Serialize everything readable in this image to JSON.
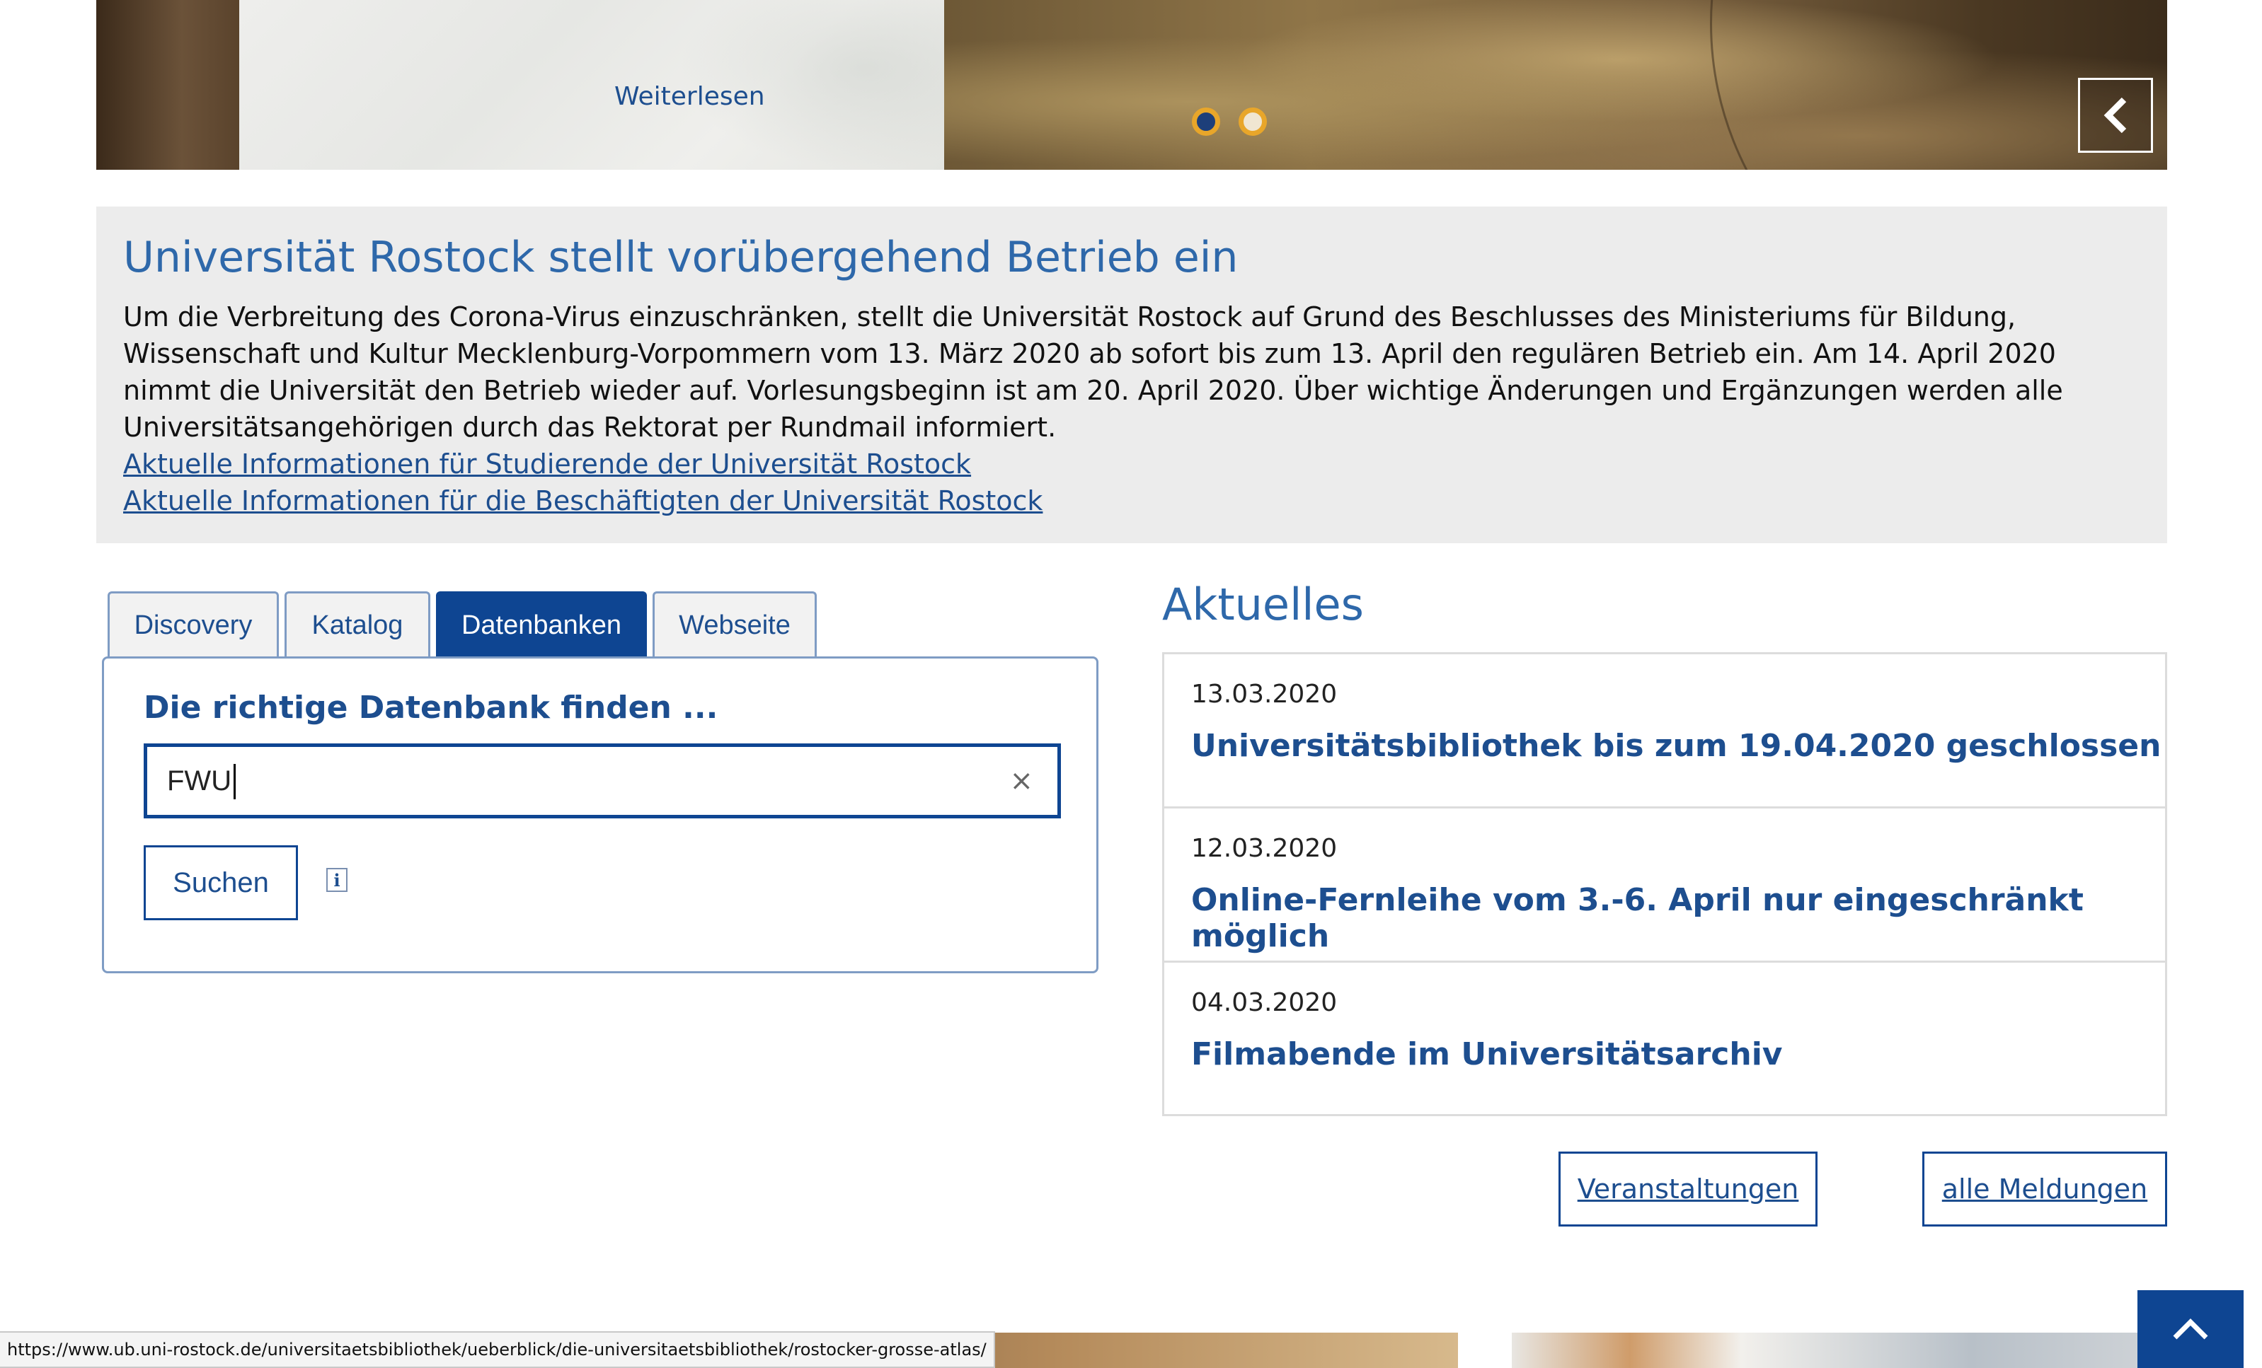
{
  "slider": {
    "read_more": "Weiterlesen",
    "prev_icon": "chevron-left-icon",
    "next_icon": "chevron-right-icon"
  },
  "notice": {
    "title": "Universität Rostock stellt vorübergehend Betrieb ein",
    "text": "Um die Verbreitung des Corona-Virus einzuschränken, stellt die Universität Rostock auf Grund des Beschlusses des Ministeriums für Bildung, Wissenschaft und Kultur Mecklenburg-Vorpommern vom 13. März 2020 ab sofort bis zum 13. April den regulären Betrieb ein. Am 14. April 2020 nimmt die Universität den Betrieb wieder auf. Vorlesungsbeginn ist am 20. April 2020. Über wichtige Änderungen und Ergänzungen werden alle Universitätsangehörigen durch das Rektorat per Rundmail informiert.",
    "links": [
      "Aktuelle Informationen für Studierende der Universität Rostock",
      "Aktuelle Informationen für die Beschäftigten der Universität Rostock"
    ]
  },
  "search": {
    "tabs": [
      "Discovery",
      "Katalog",
      "Datenbanken",
      "Webseite"
    ],
    "active_tab": "Datenbanken",
    "title": "Die richtige Datenbank finden ...",
    "input_value": "FWU",
    "clear_icon": "×",
    "button_label": "Suchen",
    "info_icon": "i"
  },
  "news": {
    "heading": "Aktuelles",
    "items": [
      {
        "date": "13.03.2020",
        "title": "Universitätsbibliothek bis zum 19.04.2020 geschlossen"
      },
      {
        "date": "12.03.2020",
        "title": "Online-Fernleihe vom 3.-6. April nur eingeschränkt möglich"
      },
      {
        "date": "04.03.2020",
        "title": "Filmabende im Universitätsarchiv"
      }
    ],
    "events_button": "Veranstaltungen",
    "all_news_button": "alle Meldungen"
  },
  "status_bar": {
    "url": "https://www.ub.uni-rostock.de/universitaetsbibliothek/ueberblick/die-universitaetsbibliothek/rostocker-grosse-atlas/"
  },
  "colors": {
    "brand_blue": "#0e4592",
    "heading_blue": "#2e68aa",
    "accent_orange": "#e8a62a",
    "notice_bg": "#ececec"
  }
}
